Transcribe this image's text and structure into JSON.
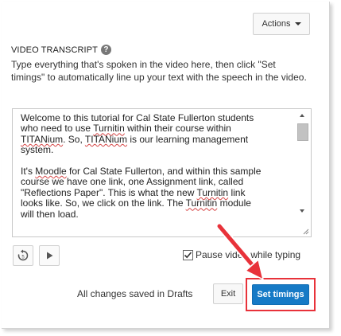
{
  "toolbar": {
    "actions_label": "Actions",
    "actions_icon": "chevron-down-icon"
  },
  "transcript_section": {
    "title": "VIDEO TRANSCRIPT",
    "help_icon": "?",
    "instructions": "Type everything that's spoken in the video here, then click \"Set timings\" to automatically line up your text with the speech in the video."
  },
  "transcript": {
    "paragraph1": [
      {
        "t": "Welcome to this tutorial for Cal State Fullerton students\nwho need to use "
      },
      {
        "t": "Turnitin",
        "u": true
      },
      {
        "t": " within their course within\n"
      },
      {
        "t": "TITANium",
        "u": true
      },
      {
        "t": ". So, "
      },
      {
        "t": "TITANium",
        "u": true
      },
      {
        "t": " is our learning management\nsystem."
      }
    ],
    "paragraph2": [
      {
        "t": "It's "
      },
      {
        "t": "Moodle",
        "u": true
      },
      {
        "t": " for Cal State Fullerton, and within this sample\ncourse we have one link, one Assignment link, called\n\"Reflections Paper\". This is what the new "
      },
      {
        "t": "Turnitin",
        "u": true
      },
      {
        "t": " link\nlooks like. So, we click on the link. The "
      },
      {
        "t": "Turnitin",
        "u": true
      },
      {
        "t": " module\nwill then load."
      }
    ]
  },
  "controls": {
    "replay_icon": "replay-5-seconds-icon",
    "play_icon": "play-icon",
    "pause_checkbox_checked": true,
    "pause_label": "Pause video while typing"
  },
  "footer": {
    "status": "All changes saved in Drafts",
    "exit_label": "Exit",
    "set_timings_label": "Set timings"
  },
  "colors": {
    "primary": "#167ac6",
    "highlight": "#e8323a"
  }
}
